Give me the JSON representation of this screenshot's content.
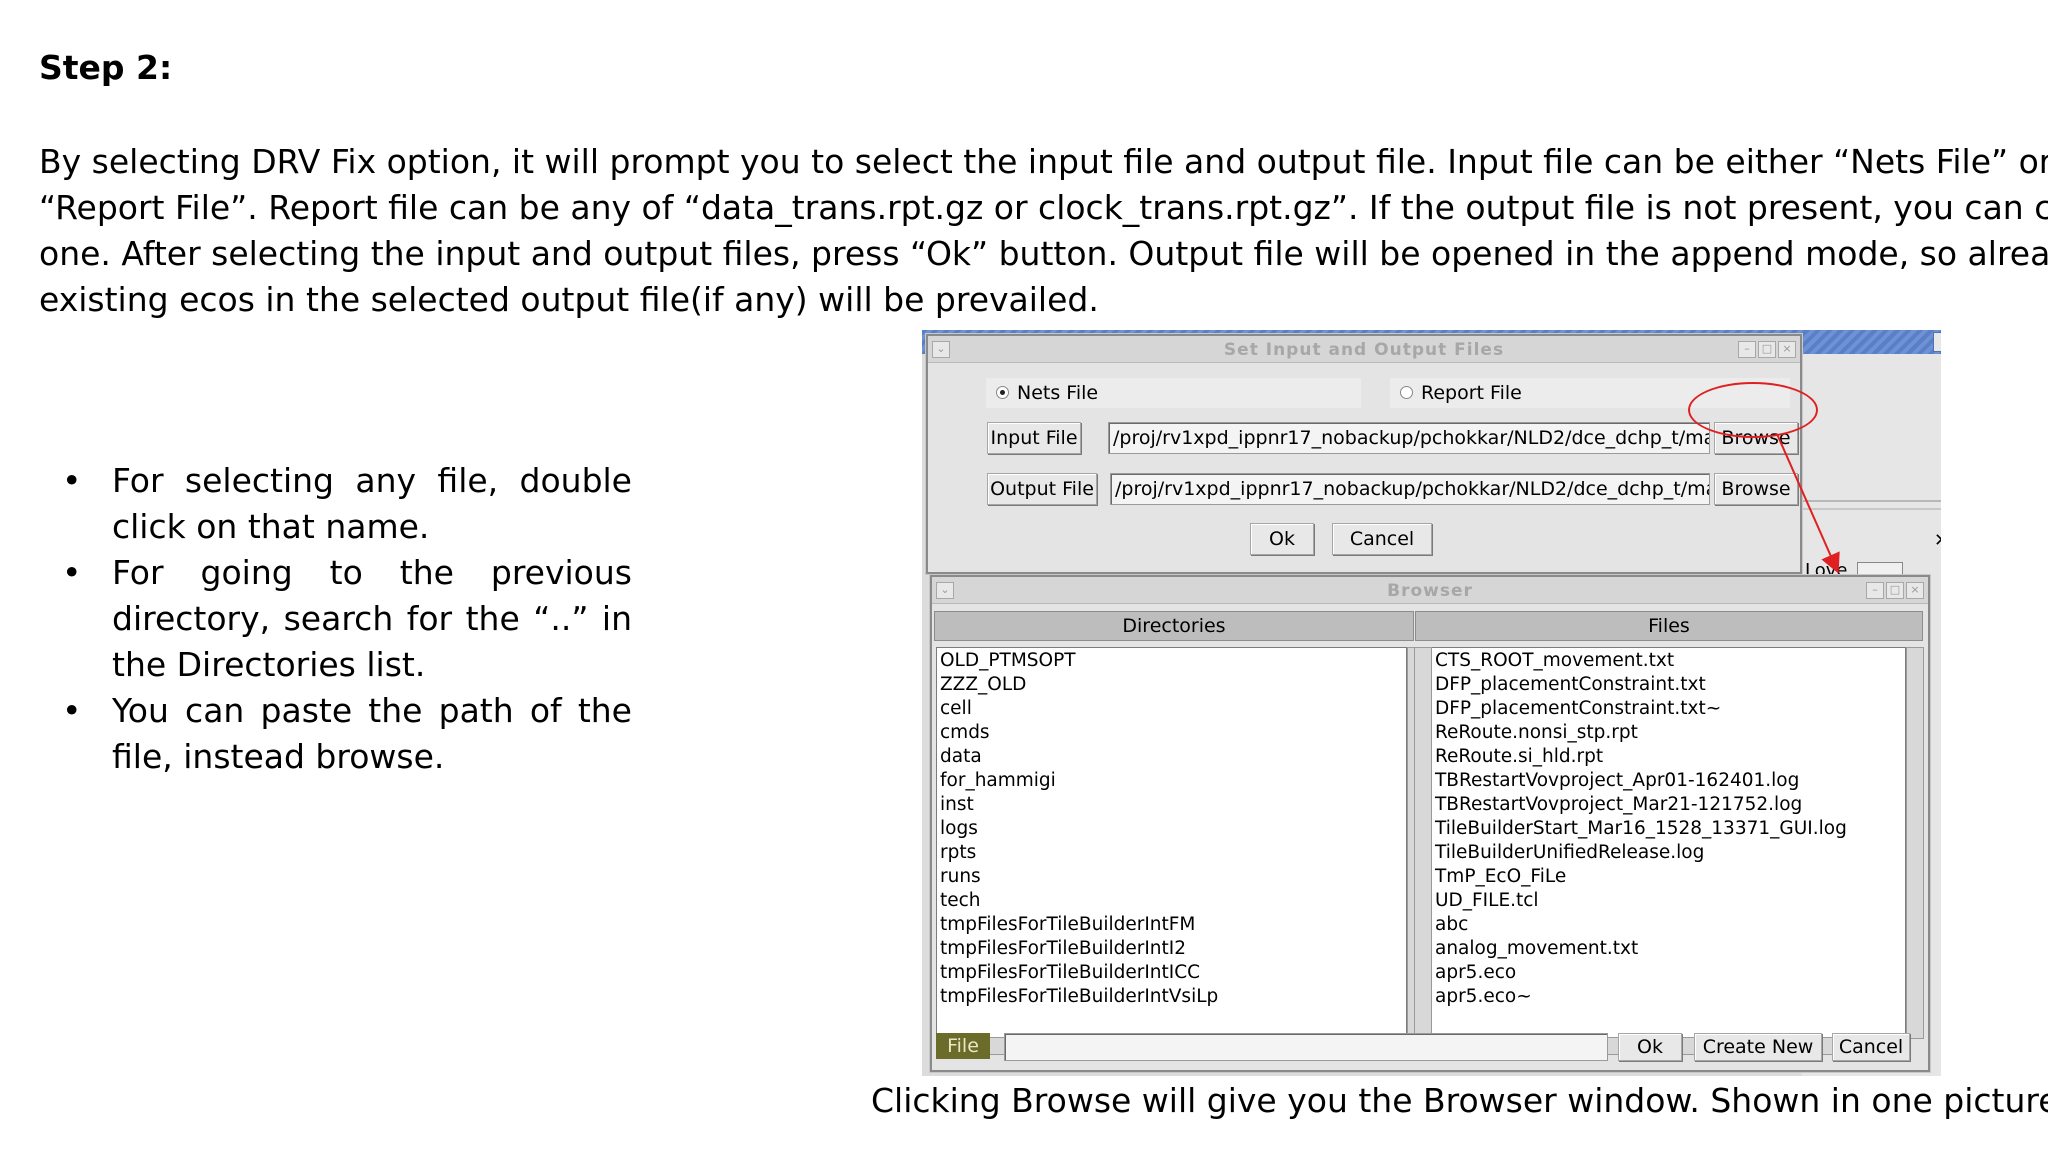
{
  "step_title": "Step 2:",
  "paragraph_lines": [
    "By selecting DRV Fix  option, it will prompt you to select the input file and output file. Input file can be either “Nets File” or",
    "“Report File”. Report file can be any of “data_trans.rpt.gz or clock_trans.rpt.gz”. If the output file is not present, you can create",
    "one. After selecting the input and output files, press “Ok” button. Output file will be opened in the append mode, so already",
    "existing ecos in the selected output file(if any) will be prevailed."
  ],
  "bullets": [
    "For selecting any file, double click on that name.",
    "For going to the previous directory, search for the “..” in the Directories list.",
    "You can paste the path of the file, instead browse."
  ],
  "caption": "Clicking Browse will give you the Browser window. Shown in one picture",
  "set_files_dialog": {
    "title": "Set Input and Output Files",
    "nets_file_label": "Nets File",
    "report_file_label": "Report File",
    "selected": "Nets File",
    "input_file_label": "Input File",
    "input_file_value": "/proj/rv1xpd_ippnr17_nobackup/pchokkar/NLD2/dce_dchp_t/main/pd",
    "output_file_label": "Output File",
    "output_file_value": "/proj/rv1xpd_ippnr17_nobackup/pchokkar/NLD2/dce_dchp_t/main/pd",
    "browse_label": "Browse",
    "ok_label": "Ok",
    "cancel_label": "Cancel"
  },
  "browser_dialog": {
    "title": "Browser",
    "directories_header": "Directories",
    "files_header": "Files",
    "directories": [
      "OLD_PTMSOPT",
      "ZZZ_OLD",
      "cell",
      "cmds",
      "data",
      "for_hammigi",
      "inst",
      "logs",
      "rpts",
      "runs",
      "tech",
      "tmpFilesForTileBuilderIntFM",
      "tmpFilesForTileBuilderIntI2",
      "tmpFilesForTileBuilderIntICC",
      "tmpFilesForTileBuilderIntVsiLp"
    ],
    "files": [
      "CTS_ROOT_movement.txt",
      "DFP_placementConstraint.txt",
      "DFP_placementConstraint.txt~",
      "ReRoute.nonsi_stp.rpt",
      "ReRoute.si_hld.rpt",
      "TBRestartVovproject_Apr01-162401.log",
      "TBRestartVovproject_Mar21-121752.log",
      "TileBuilderStart_Mar16_1528_13371_GUI.log",
      "TileBuilderUnifiedRelease.log",
      "TmP_EcO_FiLe",
      "UD_FILE.tcl",
      "abc",
      "analog_movement.txt",
      "apr5.eco",
      "apr5.eco~"
    ],
    "file_label": "File",
    "file_input_value": "",
    "ok_label": "Ok",
    "create_new_label": "Create New",
    "cancel_label": "Cancel"
  },
  "background_fragment": {
    "text": "Love"
  },
  "colors": {
    "annotation_red": "#e02020",
    "file_label_bg": "#6b6b2a",
    "titlebar_stripe": "#5a7fc5"
  }
}
